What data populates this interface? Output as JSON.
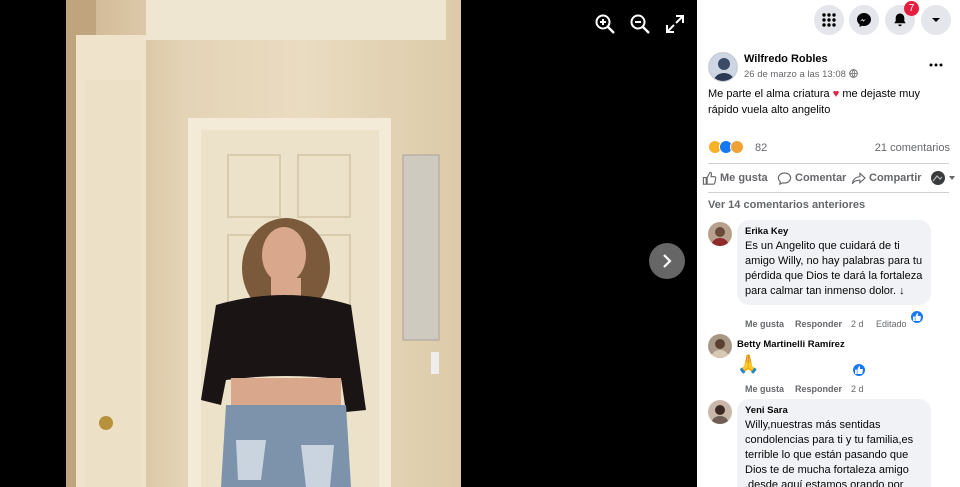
{
  "viewer": {
    "tools": [
      "zoom-in-icon",
      "zoom-out-icon",
      "fullscreen-icon"
    ],
    "next": "chevron-right-icon"
  },
  "topbar": {
    "notifications_count": "7"
  },
  "post": {
    "author": "Wilfredo Robles",
    "time": "26 de marzo a las 13:08 ·",
    "text": "Me parte el alma criatura",
    "text_heart": "♥",
    "text_rest": " me dejaste muy rápido vuela alto angelito",
    "reaction_count": "82",
    "comment_count": "21 comentarios",
    "actions": {
      "like": "Me gusta",
      "comment": "Comentar",
      "share": "Compartir"
    }
  },
  "comments": {
    "view_previous": "Ver 14 comentarios anteriores",
    "items": [
      {
        "author": "Erika Key",
        "text": "Es un Angelito que cuidará de ti amigo Willy, no hay palabras para tu pérdida que Dios te dará la fortaleza para calmar tan inmenso dolor. ↓",
        "like": "Me gusta",
        "reply": "Responder",
        "time": "2 d",
        "edited": "Editado"
      },
      {
        "author": "Betty Martinelli Ramírez",
        "text": "🙏",
        "like": "Me gusta",
        "reply": "Responder",
        "time": "2 d"
      },
      {
        "author": "Yeni Sara",
        "text": "Willy,nuestras más sentidas condolencias para ti y tu familia,es terrible lo que están pasando que Dios te de mucha fortaleza amigo ,desde aquí estamos orando por"
      }
    ]
  },
  "colors": {
    "accent": "#1877f2",
    "badge": "#e41e3f",
    "bubble": "#f0f2f5",
    "muted": "#65676b"
  }
}
